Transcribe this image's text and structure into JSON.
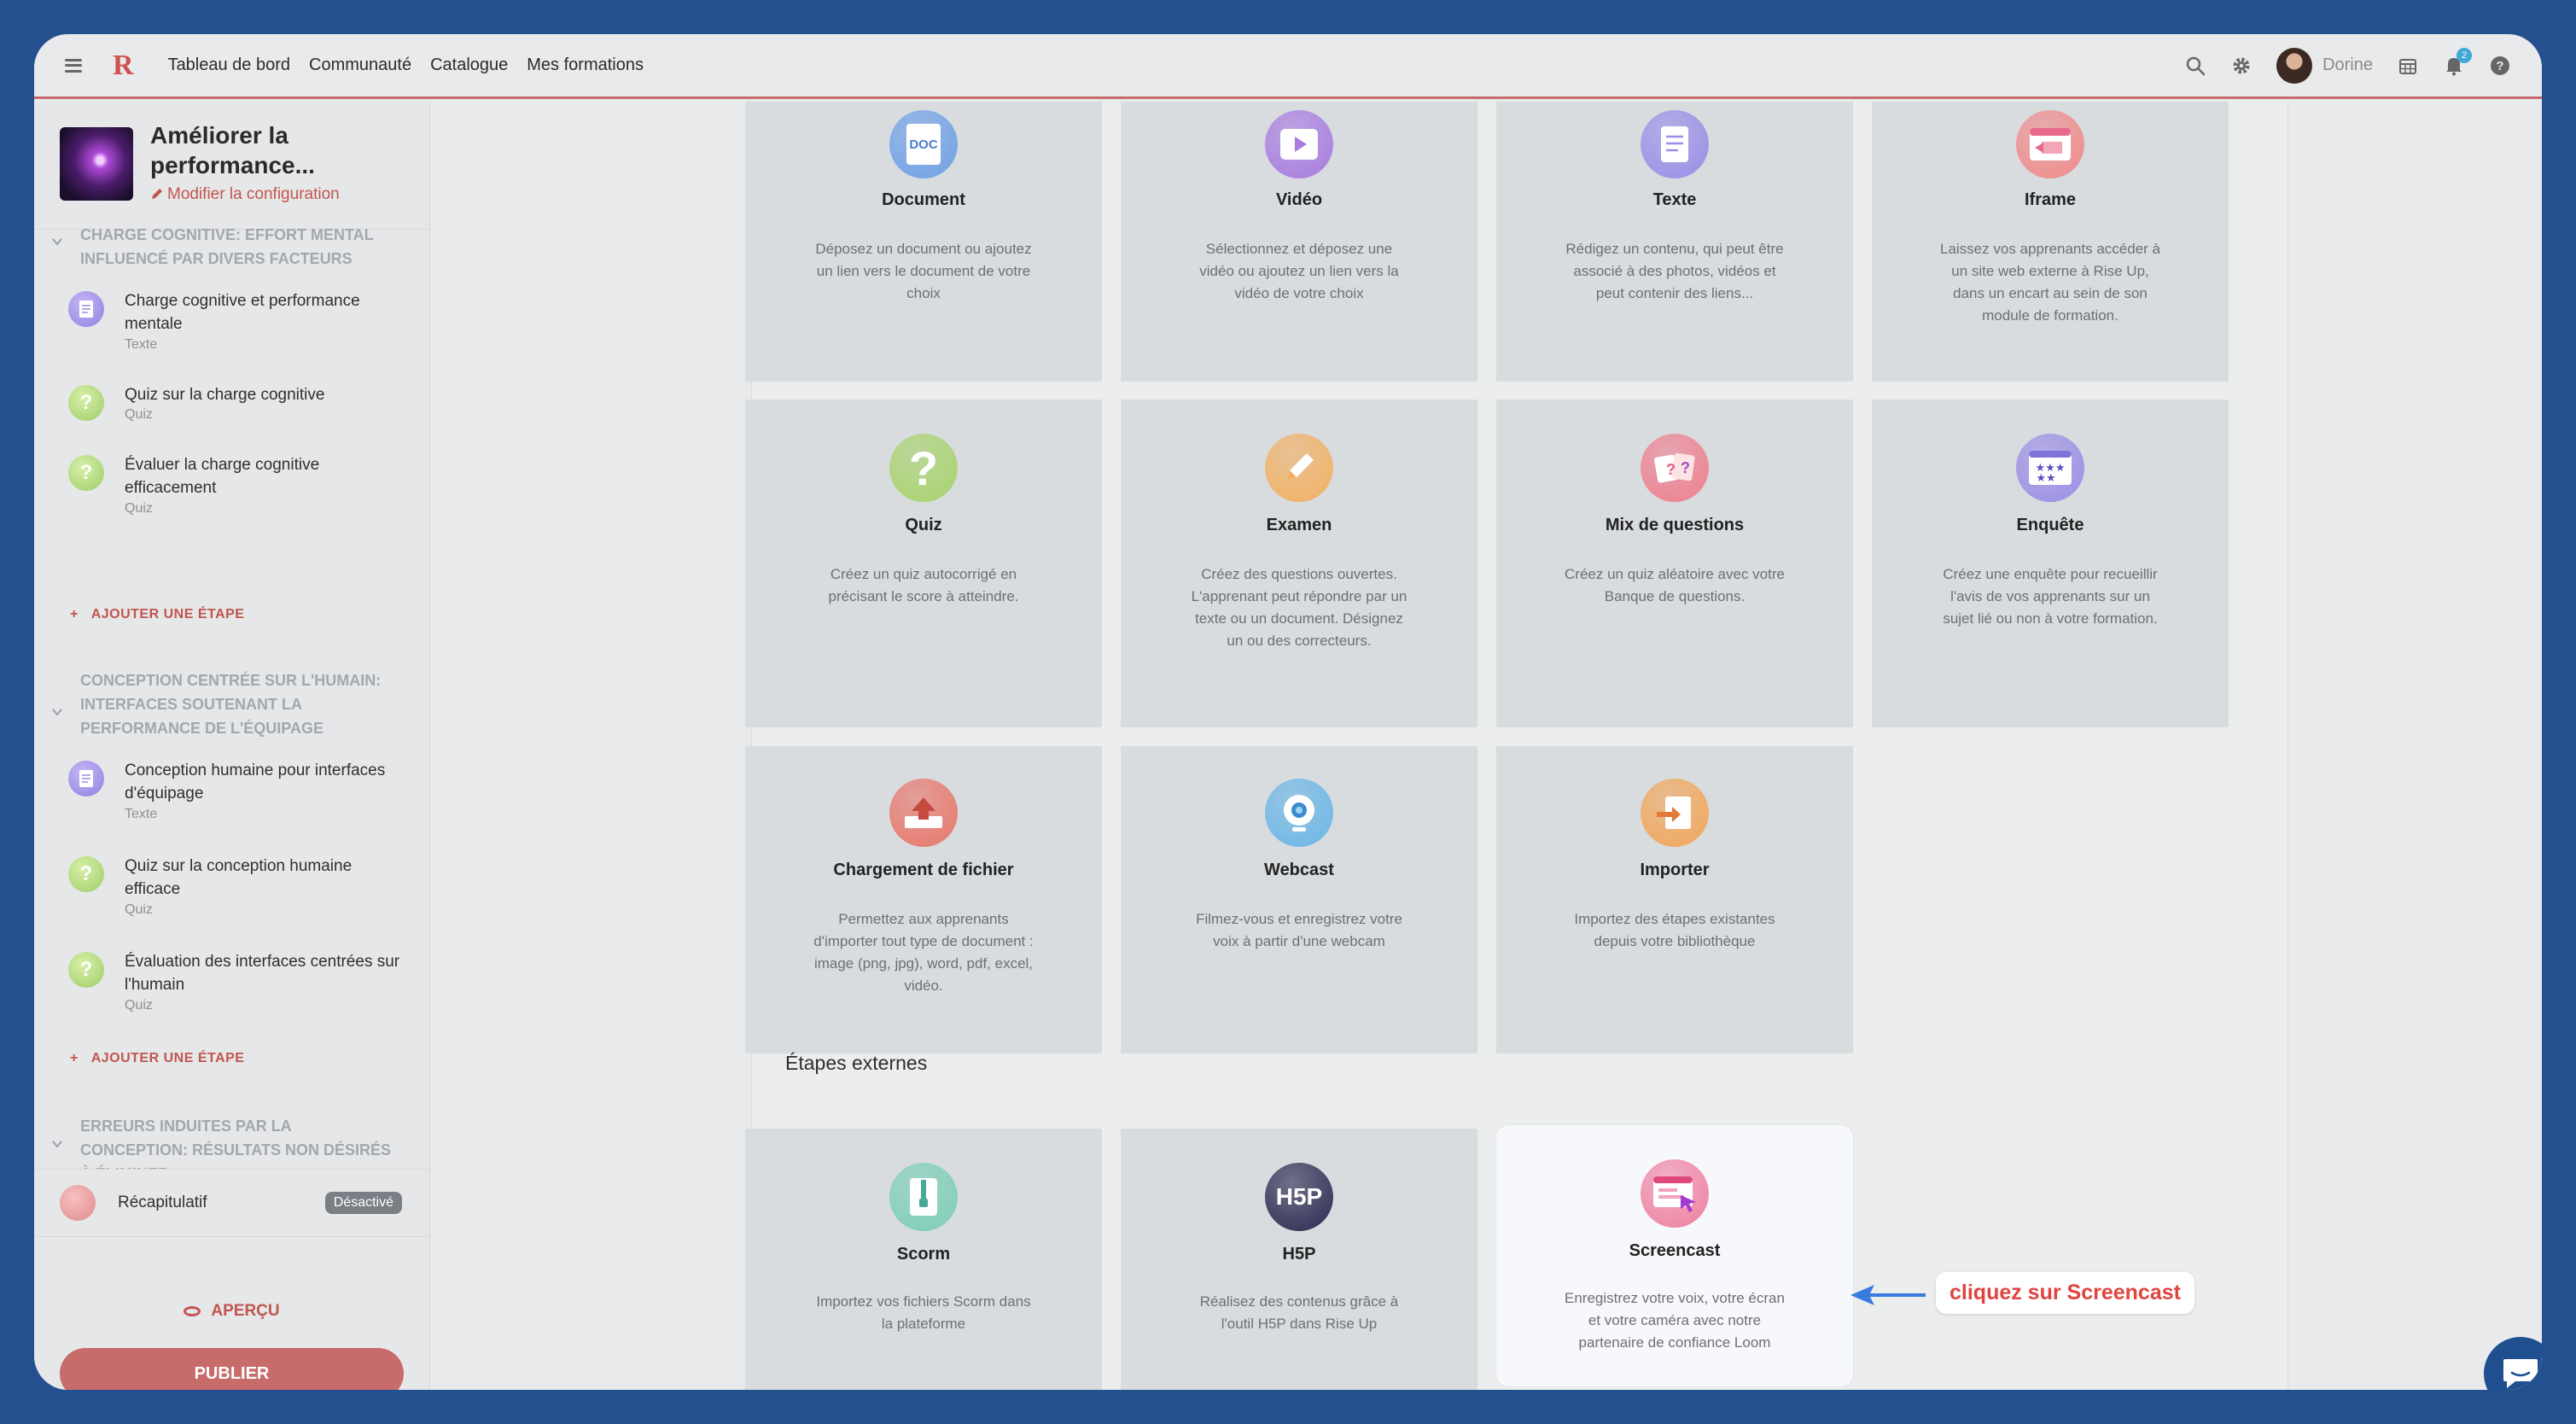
{
  "header": {
    "nav": [
      "Tableau de bord",
      "Communauté",
      "Catalogue",
      "Mes formations"
    ],
    "user_name": "Dorine",
    "notification_count": "2",
    "colors": {
      "accent": "#c2554f",
      "badge": "#3fa8d6"
    }
  },
  "sidebar": {
    "course_title": "Améliorer la performance...",
    "edit_config": "Modifier la configuration",
    "sections": [
      {
        "title": "CHARGE COGNITIVE: EFFORT MENTAL INFLUENCÉ PAR DIVERS FACTEURS",
        "steps": [
          {
            "title": "Charge cognitive et performance mentale",
            "type": "Texte",
            "icon": "document-icon"
          },
          {
            "title": "Quiz sur la charge cognitive",
            "type": "Quiz",
            "icon": "question-icon"
          },
          {
            "title": "Évaluer la charge cognitive efficacement",
            "type": "Quiz",
            "icon": "question-icon"
          }
        ],
        "add_step": "AJOUTER UNE ÉTAPE"
      },
      {
        "title": "CONCEPTION CENTRÉE SUR L'HUMAIN: INTERFACES SOUTENANT LA PERFORMANCE DE L'ÉQUIPAGE",
        "steps": [
          {
            "title": "Conception humaine pour interfaces d'équipage",
            "type": "Texte",
            "icon": "document-icon"
          },
          {
            "title": "Quiz sur la conception humaine efficace",
            "type": "Quiz",
            "icon": "question-icon"
          },
          {
            "title": "Évaluation des interfaces centrées sur l'humain",
            "type": "Quiz",
            "icon": "question-icon"
          }
        ],
        "add_step": "AJOUTER UNE ÉTAPE"
      },
      {
        "title": "ERREURS INDUITES PAR LA CONCEPTION: RÉSULTATS NON DÉSIRÉS À ÉLIMINER",
        "steps": []
      }
    ],
    "recap_label": "Récapitulatif",
    "recap_badge": "Désactivé",
    "preview_label": "APERÇU",
    "publish_label": "PUBLIER"
  },
  "main": {
    "cards": [
      {
        "title": "Document",
        "desc": "Déposez un document ou ajoutez un lien vers le document de votre choix",
        "icon": "doc-icon",
        "color": "#6fa0e6"
      },
      {
        "title": "Vidéo",
        "desc": "Sélectionnez et déposez une vidéo ou ajoutez un lien vers la vidéo de votre choix",
        "icon": "video-play-icon",
        "color": "#a87be0"
      },
      {
        "title": "Texte",
        "desc": "Rédigez un contenu, qui peut être associé à des photos, vidéos et peut contenir des liens...",
        "icon": "text-page-icon",
        "color": "#9a8ee8"
      },
      {
        "title": "Iframe",
        "desc": "Laissez vos apprenants accéder à un site web externe à Rise Up, dans un encart au sein de son module de formation.",
        "icon": "iframe-icon",
        "color": "#f08a8a"
      },
      {
        "title": "Quiz",
        "desc": "Créez un quiz autocorrigé en précisant le score à atteindre.",
        "icon": "question-icon",
        "color": "#a8d36c"
      },
      {
        "title": "Examen",
        "desc": "Créez des questions ouvertes. L'apprenant peut répondre par un texte ou un document. Désignez un ou des correcteurs.",
        "icon": "pencil-icon",
        "color": "#f3b062"
      },
      {
        "title": "Mix de questions",
        "desc": "Créez un quiz aléatoire avec votre Banque de questions.",
        "icon": "question-cards-icon",
        "color": "#ef7f8f"
      },
      {
        "title": "Enquête",
        "desc": "Créez une enquête pour recueillir l'avis de vos apprenants sur un sujet lié ou non à votre formation.",
        "icon": "survey-stars-icon",
        "color": "#9b8ee6"
      },
      {
        "title": "Chargement de fichier",
        "desc": "Permettez aux apprenants d'importer tout type de document : image (png, jpg), word, pdf, excel, vidéo.",
        "icon": "upload-icon",
        "color": "#e8766a"
      },
      {
        "title": "Webcast",
        "desc": "Filmez-vous et enregistrez votre voix à partir d'une webcam",
        "icon": "webcam-icon",
        "color": "#6ab6e6"
      },
      {
        "title": "Importer",
        "desc": "Importez des étapes existantes depuis votre bibliothèque",
        "icon": "import-icon",
        "color": "#f2a65a"
      }
    ],
    "external_heading": "Étapes externes",
    "external_cards": [
      {
        "title": "Scorm",
        "desc": "Importez vos fichiers Scorm dans la plateforme",
        "icon": "zip-file-icon",
        "color": "#7dcfb6"
      },
      {
        "title": "H5P",
        "desc": "Réalisez des contenus grâce à l'outil H5P dans Rise Up",
        "icon": "h5p-logo-icon",
        "color": "#2b2850",
        "label": "H5P"
      },
      {
        "title": "Screencast",
        "desc": "Enregistrez votre voix, votre écran et votre caméra avec notre partenaire de confiance Loom",
        "icon": "screencast-icon",
        "color": "#ee7fa0"
      }
    ],
    "callout": "cliquez sur Screencast",
    "doc_label": "DOC"
  }
}
